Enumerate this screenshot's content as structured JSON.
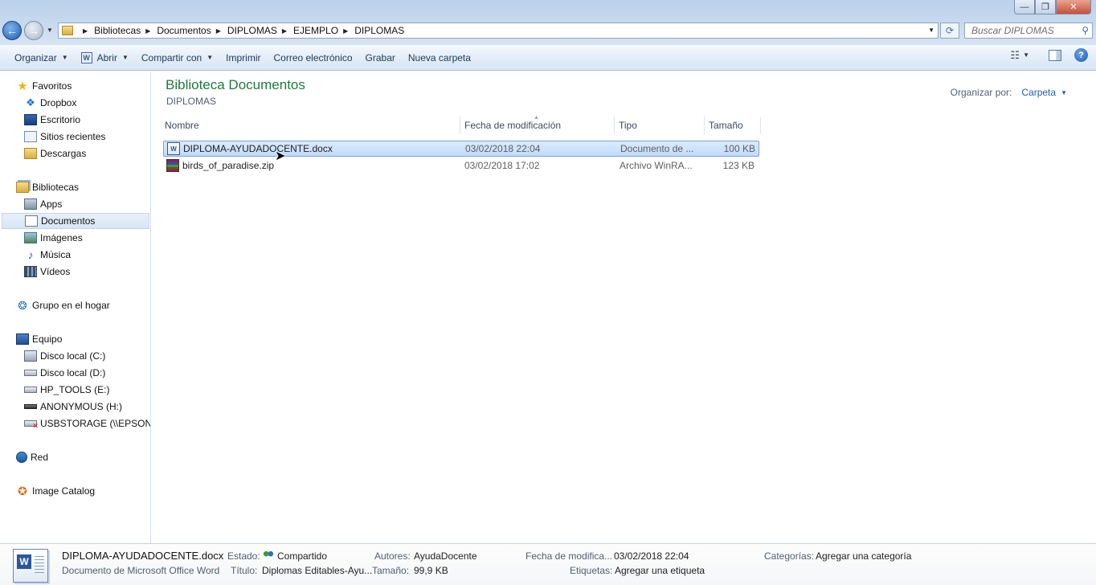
{
  "window": {
    "minimize": "—",
    "maximize": "❐",
    "close": "✕"
  },
  "address": {
    "breadcrumbs": [
      "Bibliotecas",
      "Documentos",
      "DIPLOMAS",
      "EJEMPLO",
      "DIPLOMAS"
    ]
  },
  "search": {
    "placeholder": "Buscar DIPLOMAS"
  },
  "toolbar": {
    "organize": "Organizar",
    "open": "Abrir",
    "share": "Compartir con",
    "print": "Imprimir",
    "email": "Correo electrónico",
    "burn": "Grabar",
    "new_folder": "Nueva carpeta"
  },
  "sidebar": {
    "favorites": "Favoritos",
    "dropbox": "Dropbox",
    "desktop": "Escritorio",
    "recent": "Sitios recientes",
    "downloads": "Descargas",
    "libraries": "Bibliotecas",
    "apps": "Apps",
    "documents": "Documentos",
    "images": "Imágenes",
    "music": "Música",
    "videos": "Vídeos",
    "homegroup": "Grupo en el hogar",
    "computer": "Equipo",
    "drive_c": "Disco local (C:)",
    "drive_d": "Disco local (D:)",
    "drive_e": "HP_TOOLS (E:)",
    "drive_h": "ANONYMOUS (H:)",
    "drive_usb": "USBSTORAGE (\\\\EPSON",
    "network": "Red",
    "catalog": "Image Catalog"
  },
  "main": {
    "title": "Biblioteca Documentos",
    "subtitle": "DIPLOMAS",
    "arrange_label": "Organizar por:",
    "arrange_value": "Carpeta"
  },
  "columns": {
    "name": "Nombre",
    "date": "Fecha de modificación",
    "type": "Tipo",
    "size": "Tamaño"
  },
  "files": [
    {
      "name": "DIPLOMA-AYUDADOCENTE.docx",
      "date": "03/02/2018 22:04",
      "type": "Documento de ...",
      "size": "100 KB"
    },
    {
      "name": "birds_of_paradise.zip",
      "date": "03/02/2018 17:02",
      "type": "Archivo WinRA...",
      "size": "123 KB"
    }
  ],
  "details": {
    "filename": "DIPLOMA-AYUDADOCENTE.docx",
    "filetype": "Documento de Microsoft Office Word",
    "status_label": "Estado:",
    "status_value": "Compartido",
    "title_label": "Título:",
    "title_value": "Diplomas Editables-Ayu...",
    "authors_label": "Autores:",
    "authors_value": "AyudaDocente",
    "size_label": "Tamaño:",
    "size_value": "99,9 KB",
    "modified_label": "Fecha de modifica...",
    "modified_value": "03/02/2018 22:04",
    "tags_label": "Etiquetas:",
    "tags_value": "Agregar una etiqueta",
    "categories_label": "Categorías:",
    "categories_value": "Agregar una categoría"
  }
}
